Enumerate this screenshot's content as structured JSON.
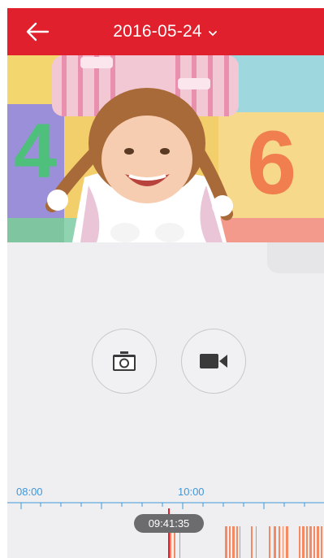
{
  "header": {
    "date": "2016-05-24",
    "back_icon": "arrow-left-icon",
    "dropdown_icon": "chevron-down-icon"
  },
  "controls": {
    "snapshot_icon": "camera-icon",
    "record_icon": "video-camera-icon"
  },
  "timeline": {
    "start_label": "08:00",
    "mid_label": "10:00",
    "current_time": "09:41:35"
  },
  "colors": {
    "header_bg": "#e0202c",
    "timeline_blue": "#3f97d9",
    "recording_orange": "#f48a64",
    "cursor_red": "#e0202c"
  }
}
